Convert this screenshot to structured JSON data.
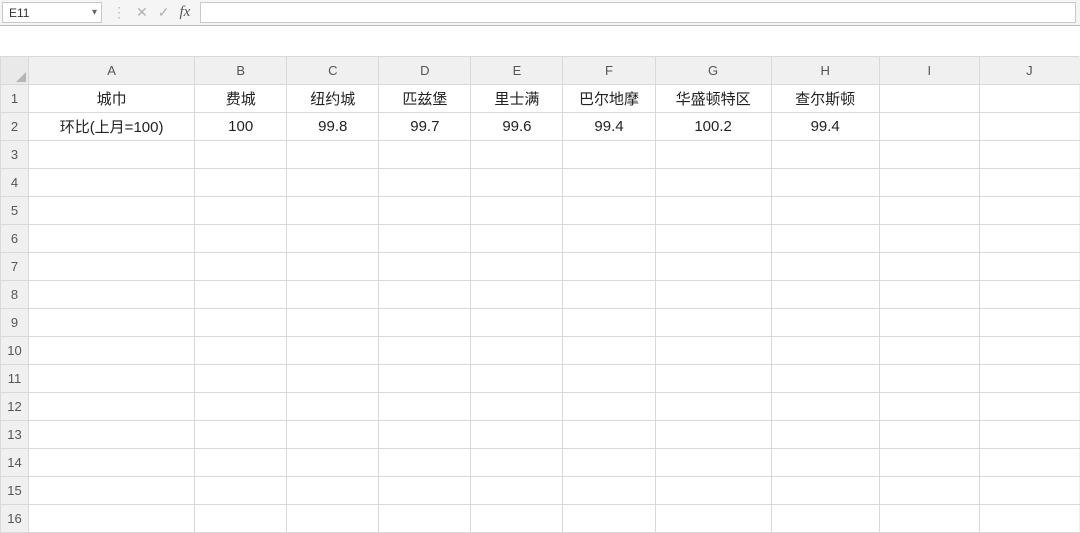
{
  "formula_bar": {
    "cell_ref": "E11",
    "formula_value": ""
  },
  "columns": [
    "A",
    "B",
    "C",
    "D",
    "E",
    "F",
    "G",
    "H",
    "I",
    "J"
  ],
  "row_count": 16,
  "cells": {
    "r1": {
      "A": "城巾",
      "B": "费城",
      "C": "纽约城",
      "D": "匹兹堡",
      "E": "里士满",
      "F": "巴尔地摩",
      "G": "华盛顿特区",
      "H": "查尔斯顿"
    },
    "r2": {
      "A": "环比(上月=100)",
      "B": "100",
      "C": "99.8",
      "D": "99.7",
      "E": "99.6",
      "F": "99.4",
      "G": "100.2",
      "H": "99.4"
    }
  },
  "chart_data": {
    "type": "table",
    "title": "",
    "categories": [
      "费城",
      "纽约城",
      "匹兹堡",
      "里士满",
      "巴尔地摩",
      "华盛顿特区",
      "查尔斯顿"
    ],
    "series": [
      {
        "name": "环比(上月=100)",
        "values": [
          100,
          99.8,
          99.7,
          99.6,
          99.4,
          100.2,
          99.4
        ]
      }
    ],
    "row_label_header": "城巾"
  }
}
